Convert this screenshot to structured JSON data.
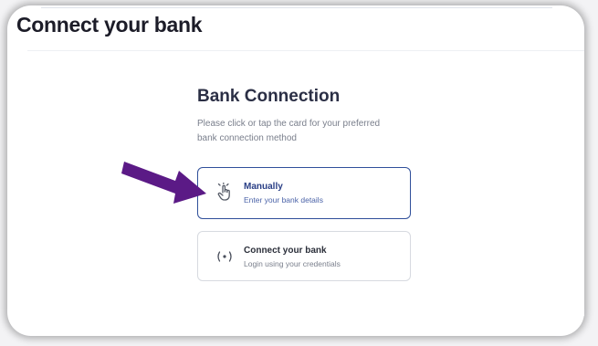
{
  "page": {
    "title": "Connect your bank"
  },
  "bank_connection": {
    "title": "Bank Connection",
    "description": "Please click or tap the card for your preferred bank connection method"
  },
  "options": [
    {
      "title": "Manually",
      "subtitle": "Enter your bank details",
      "icon": "hand-pointer-icon",
      "selected": true
    },
    {
      "title": "Connect your bank",
      "subtitle": "Login using your credentials",
      "icon": "wireless-signal-icon",
      "selected": false
    }
  ],
  "colors": {
    "accent": "#2f4f9a",
    "arrow": "#5b1a86",
    "title_text": "#2b2f45"
  }
}
